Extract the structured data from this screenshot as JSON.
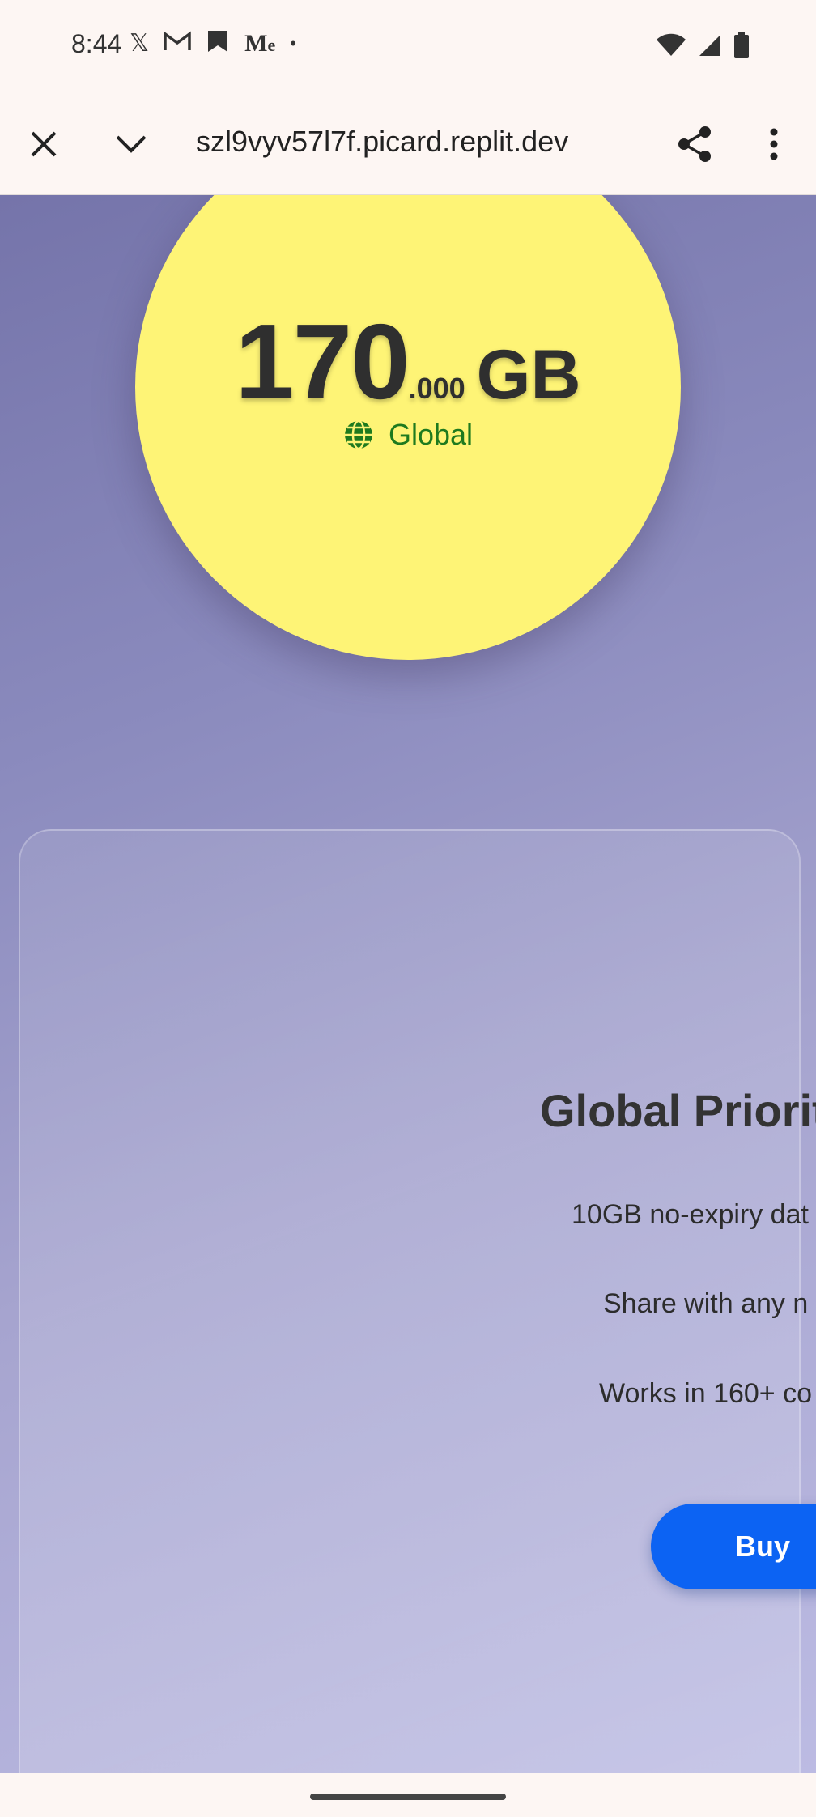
{
  "status_bar": {
    "time": "8:44",
    "notification_icons": [
      "x-icon",
      "gmail-icon",
      "bookmark-icon",
      "medium-icon",
      "dot-icon"
    ],
    "system_icons": [
      "wifi-icon",
      "signal-icon",
      "battery-icon"
    ]
  },
  "browser": {
    "url": "szl9vyv57l7f.picard.replit.dev",
    "icons": [
      "close-icon",
      "chevron-down-icon",
      "share-icon",
      "more-vert-icon"
    ]
  },
  "data_display": {
    "amount_int": "170",
    "amount_dec": ".000",
    "unit": "GB",
    "region_icon": "globe-icon",
    "region_label": "Global",
    "region_color": "#1e7a1e",
    "circle_color": "#fef476"
  },
  "plan_card": {
    "title": "Global Priorit",
    "features": [
      "10GB no-expiry dat",
      "Share with any n",
      "Works in 160+ co"
    ],
    "buy_label": "Buy",
    "buy_color": "#0c63f3"
  }
}
